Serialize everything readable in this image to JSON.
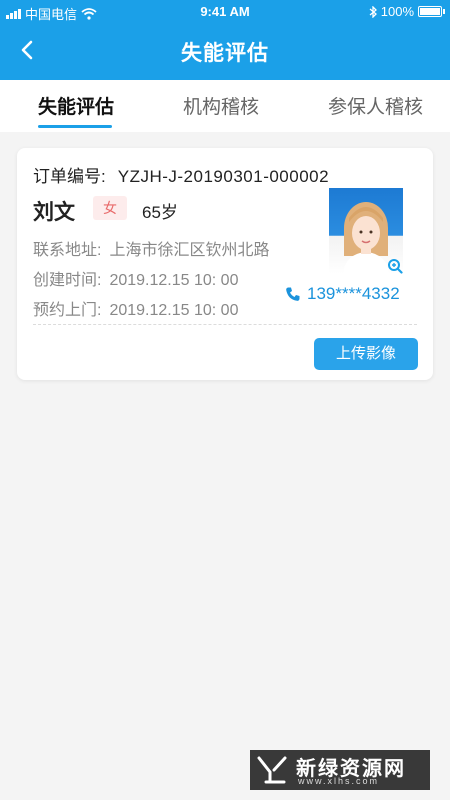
{
  "status_bar": {
    "carrier": "中国电信",
    "time": "9:41 AM",
    "battery": "100%"
  },
  "nav": {
    "title": "失能评估"
  },
  "tabs": [
    {
      "label": "失能评估",
      "active": true
    },
    {
      "label": "机构稽核",
      "active": false
    },
    {
      "label": "参保人稽核",
      "active": false
    }
  ],
  "card": {
    "order_label": "订单编号:",
    "order_number": "YZJH-J-20190301-000002",
    "name": "刘文",
    "gender": "女",
    "age": "65岁",
    "address_label": "联系地址:",
    "address": "上海市徐汇区钦州北路",
    "created_label": "创建时间:",
    "created": "2019.12.15 10: 00",
    "appointment_label": "预约上门:",
    "appointment": "2019.12.15 10: 00",
    "phone": "139****4332",
    "upload_label": "上传影像"
  },
  "watermark": {
    "text": "新绿资源网",
    "url": "www.xlhs.com"
  },
  "colors": {
    "accent": "#1ba0e8",
    "button": "#2aa3ea",
    "gender_bg": "#fdecec",
    "gender_fg": "#e86a6a"
  }
}
